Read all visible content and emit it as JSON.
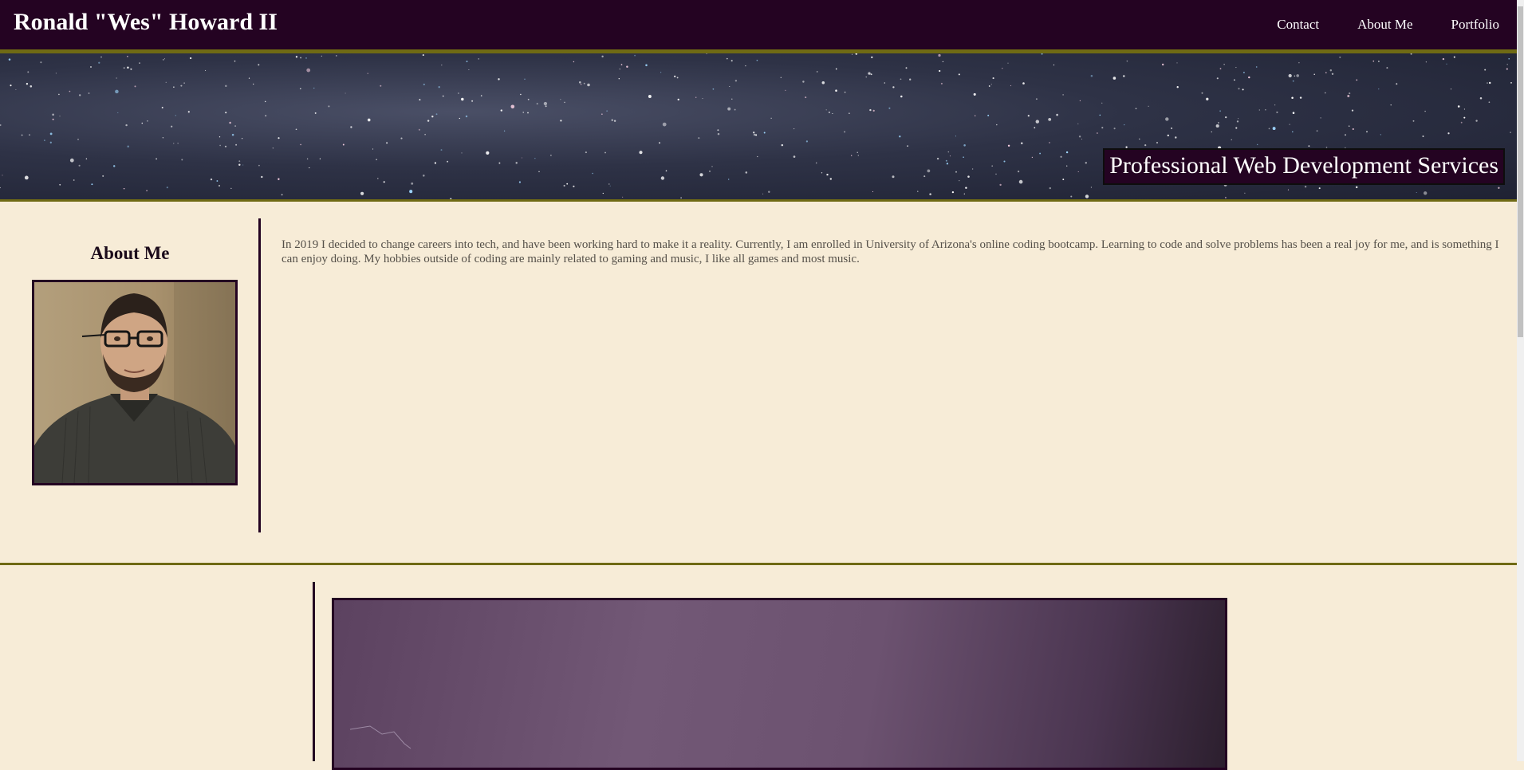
{
  "header": {
    "site_name": "Ronald \"Wes\" Howard II",
    "nav": [
      "Contact",
      "About Me",
      "Portfolio"
    ]
  },
  "hero": {
    "tagline": "Professional Web Development Services"
  },
  "about": {
    "heading": "About Me",
    "body": "In 2019 I decided to change careers into tech, and have been working hard to make it a reality. Currently, I am enrolled in University of Arizona's online coding bootcamp. Learning to code and solve problems has been a real joy for me, and is something I can enjoy doing. My hobbies outside of coding are mainly related to gaming and music, I like all games and most music."
  },
  "colors": {
    "header_bg": "#240322",
    "accent_rule": "#6f6a14",
    "page_bg": "#f7ecd7"
  }
}
